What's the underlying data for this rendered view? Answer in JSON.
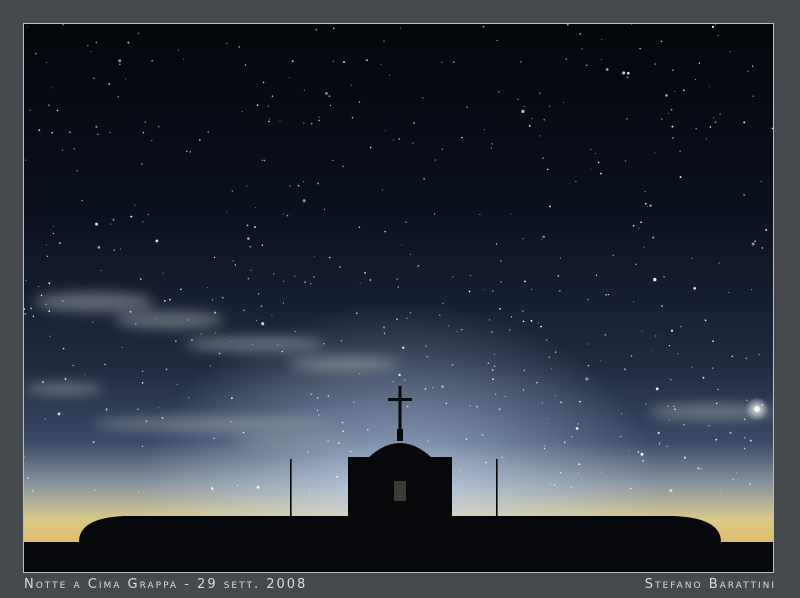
{
  "caption": {
    "title": "Notte a Cima Grappa - 29 sett. 2008",
    "author": "Stefano Barattini"
  },
  "colors": {
    "frame": "#45484d",
    "sky_top": "#05070d",
    "sky_mid": "#1c2436",
    "horizon_glow": "#e7c66a",
    "silhouette": "#07080b"
  },
  "scene": {
    "subject": "church-silhouette-with-cross",
    "sky": "starry-night-sky",
    "bright_object": "planet"
  }
}
